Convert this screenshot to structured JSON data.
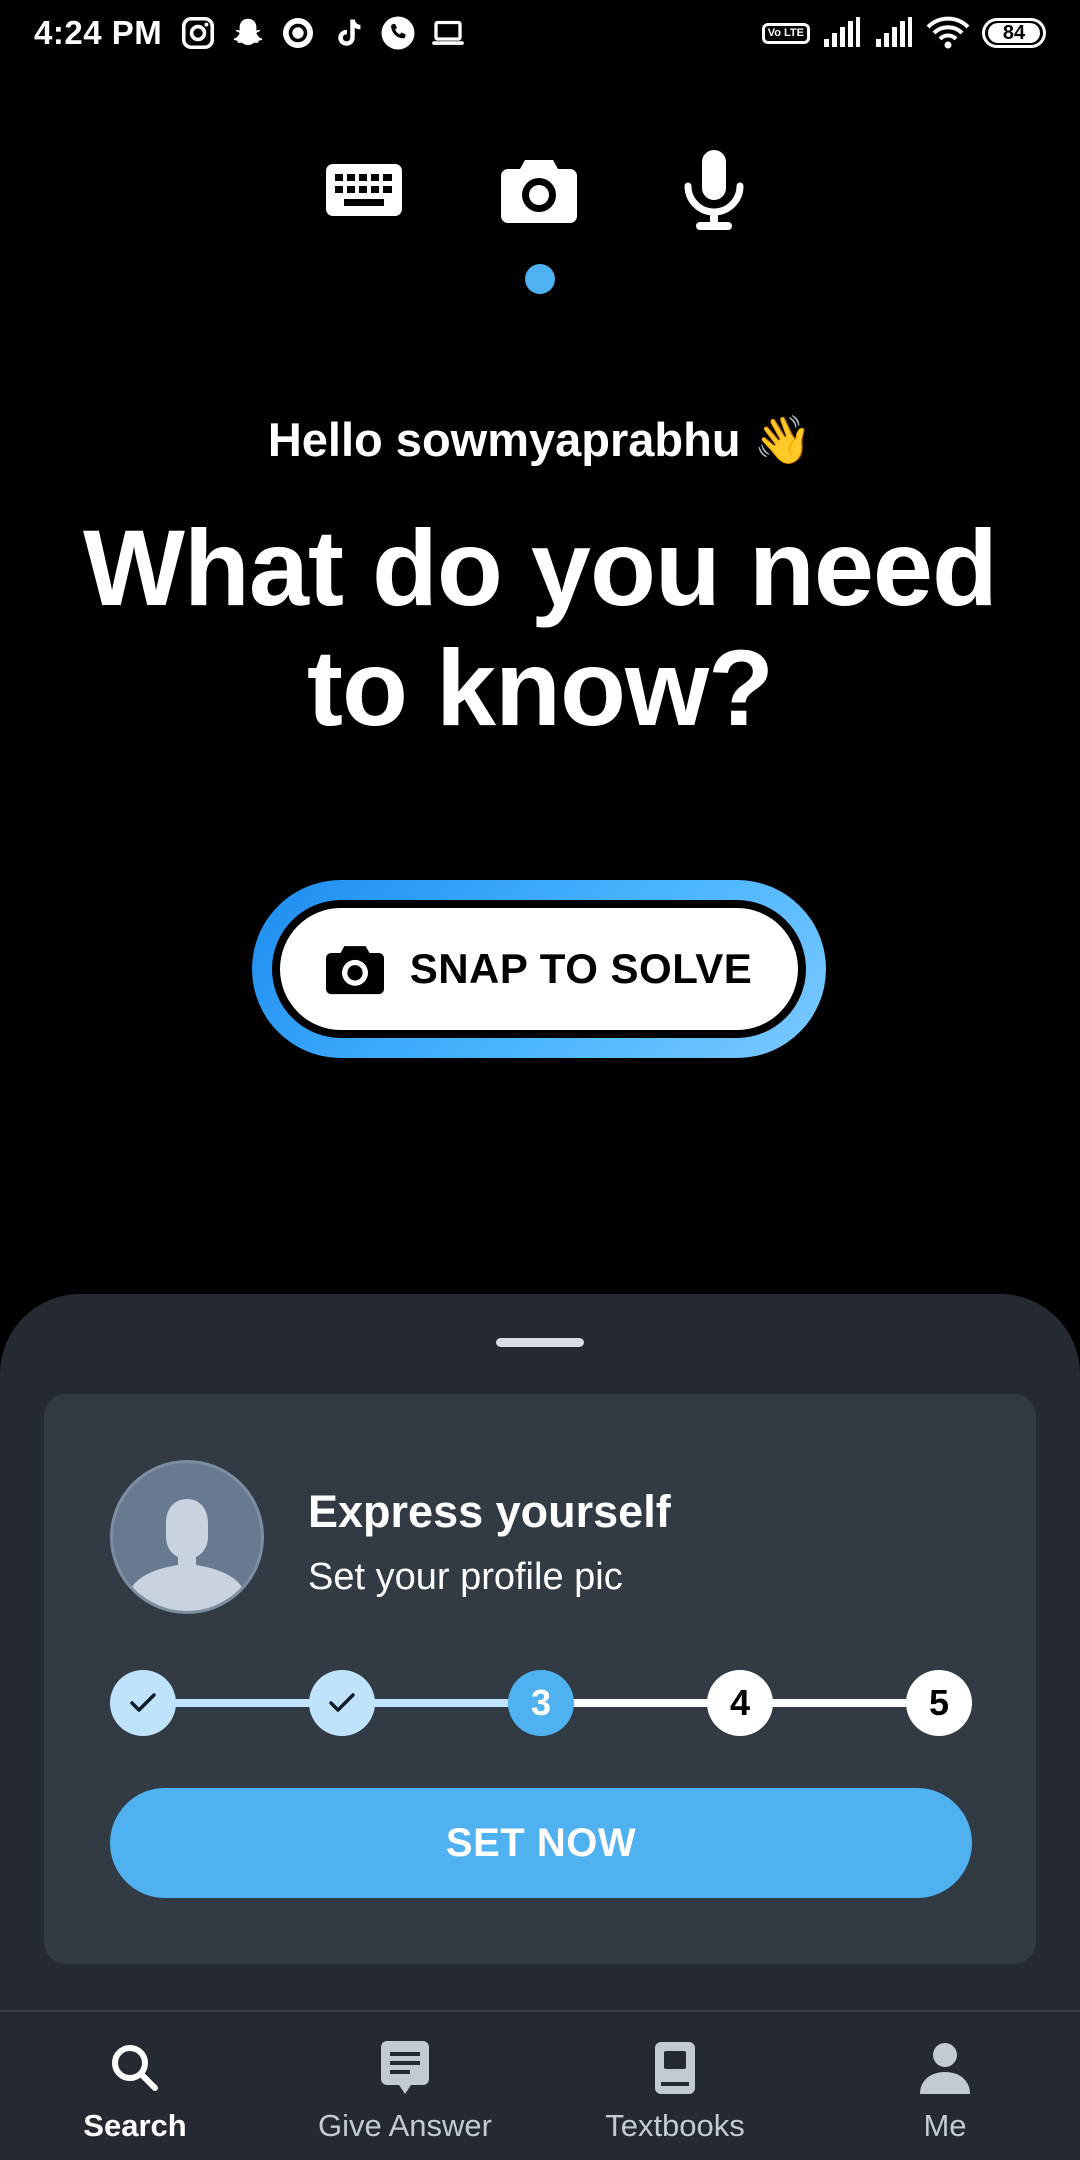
{
  "status_bar": {
    "time": "4:24 PM",
    "volte_label": "Vo LTE",
    "battery": "84",
    "left_icons": [
      "instagram-icon",
      "snapchat-icon",
      "circle-app-icon",
      "tiktok-icon",
      "phone-icon",
      "laptop-icon"
    ],
    "right_icons": [
      "volte-icon",
      "signal-icon",
      "signal-icon",
      "wifi-icon",
      "battery-icon"
    ]
  },
  "modes": {
    "items": [
      "keyboard-icon",
      "camera-icon",
      "microphone-icon"
    ],
    "selected": "camera-icon",
    "indicator_color": "#4fb1f0"
  },
  "hero": {
    "greeting": "Hello sowmyaprabhu 👋",
    "headline": "What do you need to know?"
  },
  "snap_button": {
    "label": "SNAP TO SOLVE",
    "icon": "camera-icon"
  },
  "onboarding_card": {
    "title": "Express yourself",
    "subtitle": "Set your profile pic",
    "steps": [
      {
        "label": "",
        "state": "done"
      },
      {
        "label": "",
        "state": "done"
      },
      {
        "label": "3",
        "state": "current"
      },
      {
        "label": "4",
        "state": "todo"
      },
      {
        "label": "5",
        "state": "todo"
      }
    ],
    "cta": "SET NOW"
  },
  "bottom_nav": {
    "items": [
      {
        "label": "Search",
        "icon": "search-icon",
        "active": true
      },
      {
        "label": "Give Answer",
        "icon": "answer-icon",
        "active": false
      },
      {
        "label": "Textbooks",
        "icon": "book-icon",
        "active": false
      },
      {
        "label": "Me",
        "icon": "profile-icon",
        "active": false
      }
    ]
  },
  "colors": {
    "background": "#000000",
    "accent": "#4fb1f0",
    "sheet": "#252a32",
    "card": "#323a44"
  }
}
